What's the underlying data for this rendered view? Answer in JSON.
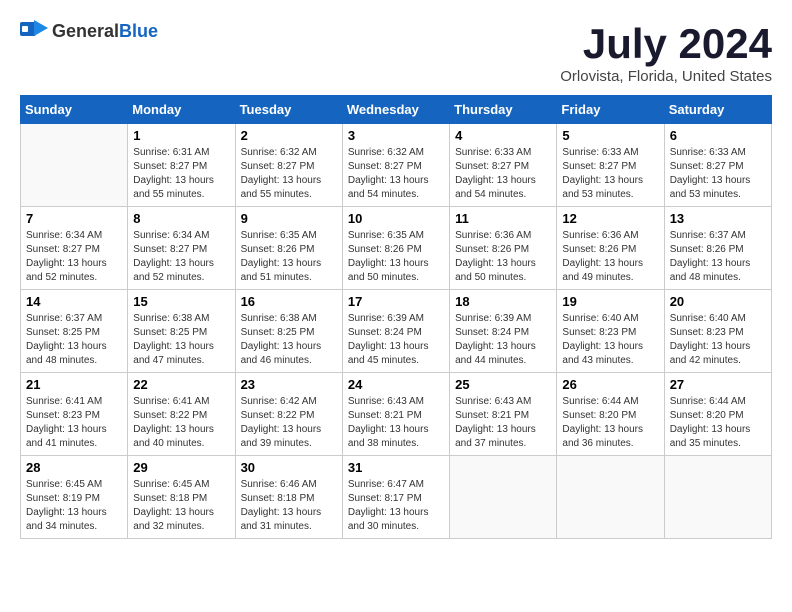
{
  "logo": {
    "general": "General",
    "blue": "Blue"
  },
  "header": {
    "title": "July 2024",
    "subtitle": "Orlovista, Florida, United States"
  },
  "weekdays": [
    "Sunday",
    "Monday",
    "Tuesday",
    "Wednesday",
    "Thursday",
    "Friday",
    "Saturday"
  ],
  "weeks": [
    [
      {
        "day": "",
        "info": ""
      },
      {
        "day": "1",
        "info": "Sunrise: 6:31 AM\nSunset: 8:27 PM\nDaylight: 13 hours\nand 55 minutes."
      },
      {
        "day": "2",
        "info": "Sunrise: 6:32 AM\nSunset: 8:27 PM\nDaylight: 13 hours\nand 55 minutes."
      },
      {
        "day": "3",
        "info": "Sunrise: 6:32 AM\nSunset: 8:27 PM\nDaylight: 13 hours\nand 54 minutes."
      },
      {
        "day": "4",
        "info": "Sunrise: 6:33 AM\nSunset: 8:27 PM\nDaylight: 13 hours\nand 54 minutes."
      },
      {
        "day": "5",
        "info": "Sunrise: 6:33 AM\nSunset: 8:27 PM\nDaylight: 13 hours\nand 53 minutes."
      },
      {
        "day": "6",
        "info": "Sunrise: 6:33 AM\nSunset: 8:27 PM\nDaylight: 13 hours\nand 53 minutes."
      }
    ],
    [
      {
        "day": "7",
        "info": "Sunrise: 6:34 AM\nSunset: 8:27 PM\nDaylight: 13 hours\nand 52 minutes."
      },
      {
        "day": "8",
        "info": "Sunrise: 6:34 AM\nSunset: 8:27 PM\nDaylight: 13 hours\nand 52 minutes."
      },
      {
        "day": "9",
        "info": "Sunrise: 6:35 AM\nSunset: 8:26 PM\nDaylight: 13 hours\nand 51 minutes."
      },
      {
        "day": "10",
        "info": "Sunrise: 6:35 AM\nSunset: 8:26 PM\nDaylight: 13 hours\nand 50 minutes."
      },
      {
        "day": "11",
        "info": "Sunrise: 6:36 AM\nSunset: 8:26 PM\nDaylight: 13 hours\nand 50 minutes."
      },
      {
        "day": "12",
        "info": "Sunrise: 6:36 AM\nSunset: 8:26 PM\nDaylight: 13 hours\nand 49 minutes."
      },
      {
        "day": "13",
        "info": "Sunrise: 6:37 AM\nSunset: 8:26 PM\nDaylight: 13 hours\nand 48 minutes."
      }
    ],
    [
      {
        "day": "14",
        "info": "Sunrise: 6:37 AM\nSunset: 8:25 PM\nDaylight: 13 hours\nand 48 minutes."
      },
      {
        "day": "15",
        "info": "Sunrise: 6:38 AM\nSunset: 8:25 PM\nDaylight: 13 hours\nand 47 minutes."
      },
      {
        "day": "16",
        "info": "Sunrise: 6:38 AM\nSunset: 8:25 PM\nDaylight: 13 hours\nand 46 minutes."
      },
      {
        "day": "17",
        "info": "Sunrise: 6:39 AM\nSunset: 8:24 PM\nDaylight: 13 hours\nand 45 minutes."
      },
      {
        "day": "18",
        "info": "Sunrise: 6:39 AM\nSunset: 8:24 PM\nDaylight: 13 hours\nand 44 minutes."
      },
      {
        "day": "19",
        "info": "Sunrise: 6:40 AM\nSunset: 8:23 PM\nDaylight: 13 hours\nand 43 minutes."
      },
      {
        "day": "20",
        "info": "Sunrise: 6:40 AM\nSunset: 8:23 PM\nDaylight: 13 hours\nand 42 minutes."
      }
    ],
    [
      {
        "day": "21",
        "info": "Sunrise: 6:41 AM\nSunset: 8:23 PM\nDaylight: 13 hours\nand 41 minutes."
      },
      {
        "day": "22",
        "info": "Sunrise: 6:41 AM\nSunset: 8:22 PM\nDaylight: 13 hours\nand 40 minutes."
      },
      {
        "day": "23",
        "info": "Sunrise: 6:42 AM\nSunset: 8:22 PM\nDaylight: 13 hours\nand 39 minutes."
      },
      {
        "day": "24",
        "info": "Sunrise: 6:43 AM\nSunset: 8:21 PM\nDaylight: 13 hours\nand 38 minutes."
      },
      {
        "day": "25",
        "info": "Sunrise: 6:43 AM\nSunset: 8:21 PM\nDaylight: 13 hours\nand 37 minutes."
      },
      {
        "day": "26",
        "info": "Sunrise: 6:44 AM\nSunset: 8:20 PM\nDaylight: 13 hours\nand 36 minutes."
      },
      {
        "day": "27",
        "info": "Sunrise: 6:44 AM\nSunset: 8:20 PM\nDaylight: 13 hours\nand 35 minutes."
      }
    ],
    [
      {
        "day": "28",
        "info": "Sunrise: 6:45 AM\nSunset: 8:19 PM\nDaylight: 13 hours\nand 34 minutes."
      },
      {
        "day": "29",
        "info": "Sunrise: 6:45 AM\nSunset: 8:18 PM\nDaylight: 13 hours\nand 32 minutes."
      },
      {
        "day": "30",
        "info": "Sunrise: 6:46 AM\nSunset: 8:18 PM\nDaylight: 13 hours\nand 31 minutes."
      },
      {
        "day": "31",
        "info": "Sunrise: 6:47 AM\nSunset: 8:17 PM\nDaylight: 13 hours\nand 30 minutes."
      },
      {
        "day": "",
        "info": ""
      },
      {
        "day": "",
        "info": ""
      },
      {
        "day": "",
        "info": ""
      }
    ]
  ]
}
